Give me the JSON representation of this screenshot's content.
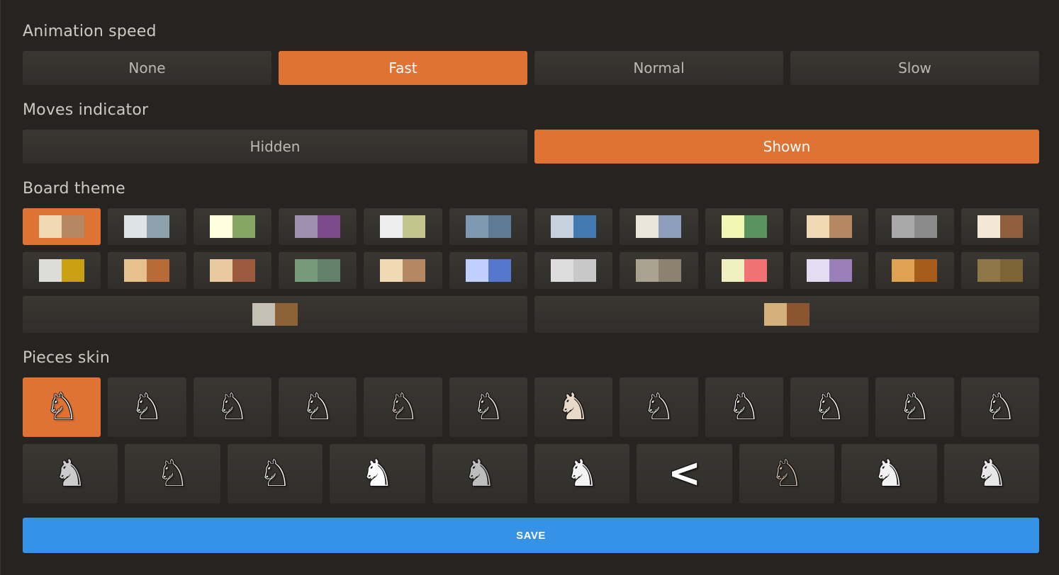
{
  "animation_speed": {
    "title": "Animation speed",
    "options": [
      "None",
      "Fast",
      "Normal",
      "Slow"
    ],
    "selected": "Fast"
  },
  "moves_indicator": {
    "title": "Moves indicator",
    "options": [
      "Hidden",
      "Shown"
    ],
    "selected": "Shown"
  },
  "board_theme": {
    "title": "Board theme",
    "selected_index": 0,
    "themes": [
      {
        "light": "#f0d9b5",
        "dark": "#b58863"
      },
      {
        "light": "#dee3e6",
        "dark": "#8ca2ad"
      },
      {
        "light": "#ffffdd",
        "dark": "#86a666"
      },
      {
        "light": "#9f90b0",
        "dark": "#7d4a8d"
      },
      {
        "light": "#eeeeee",
        "dark": "#c4c48f"
      },
      {
        "light": "#8099b2",
        "dark": "#5f7a94"
      },
      {
        "light": "#c6d1de",
        "dark": "#4279b2"
      },
      {
        "light": "#ece6da",
        "dark": "#8d9ebc"
      },
      {
        "light": "#f1f6b2",
        "dark": "#59935d"
      },
      {
        "light": "#f0d9b5",
        "dark": "#b58863"
      },
      {
        "light": "#a9a9a9",
        "dark": "#8b8b8b"
      },
      {
        "light": "#f4e7d6",
        "dark": "#8f5e3c"
      },
      {
        "light": "#dcdcd8",
        "dark": "#c9a012"
      },
      {
        "light": "#e6c08d",
        "dark": "#b86b36"
      },
      {
        "light": "#e8c9a0",
        "dark": "#9c5a3e"
      },
      {
        "light": "#779a7c",
        "dark": "#62806a"
      },
      {
        "light": "#f0d9b5",
        "dark": "#b58863"
      },
      {
        "light": "#bfcfff",
        "dark": "#5577cc"
      },
      {
        "light": "#dddddd",
        "dark": "#c8c8c8"
      },
      {
        "light": "#a9a28f",
        "dark": "#8b8370"
      },
      {
        "light": "#efefbf",
        "dark": "#f07272"
      },
      {
        "light": "#e4dcf0",
        "dark": "#9a7fb8"
      },
      {
        "light": "#dfa253",
        "dark": "#a85c1c"
      },
      {
        "light": "#8e7648",
        "dark": "#7d6436"
      },
      {
        "light": "#c6bfb4",
        "dark": "#8e6237"
      },
      {
        "light": "#d4b07a",
        "dark": "#8a5530"
      }
    ]
  },
  "pieces_skin": {
    "title": "Pieces skin",
    "selected_index": 0,
    "pieces": [
      {
        "glyph": "♘",
        "fill": "#ffffff"
      },
      {
        "glyph": "♘",
        "fill": "#ffffff"
      },
      {
        "glyph": "♘",
        "fill": "#e8e8e8"
      },
      {
        "glyph": "♘",
        "fill": "#ffffff"
      },
      {
        "glyph": "♘",
        "fill": "#ecdccd"
      },
      {
        "glyph": "♘",
        "fill": "#f4f4f4"
      },
      {
        "glyph": "♞",
        "fill": "#e8d9c8"
      },
      {
        "glyph": "♘",
        "fill": "#f2f2ee"
      },
      {
        "glyph": "♘",
        "fill": "#ffffff"
      },
      {
        "glyph": "♘",
        "fill": "#ffffff"
      },
      {
        "glyph": "♘",
        "fill": "#ffffff"
      },
      {
        "glyph": "♘",
        "fill": "#ffffff"
      },
      {
        "glyph": "♞",
        "fill": "#cccccc"
      },
      {
        "glyph": "♘",
        "fill": "#f0e6d8"
      },
      {
        "glyph": "♘",
        "fill": "#ffffff"
      },
      {
        "glyph": "♞",
        "fill": "#ffffff"
      },
      {
        "glyph": "♞",
        "fill": "#bdbdbd"
      },
      {
        "glyph": "♞",
        "fill": "#f4f4f4"
      },
      {
        "glyph": "<",
        "fill": "#ffffff"
      },
      {
        "glyph": "♘",
        "fill": "#e3cbb4"
      },
      {
        "glyph": "♞",
        "fill": "#f2f2f2"
      },
      {
        "glyph": "♞",
        "fill": "#e8e8e8"
      }
    ]
  },
  "save_label": "SAVE",
  "colors": {
    "accent": "#df7334",
    "save": "#3692e7",
    "background": "#262420",
    "button": "#35322e"
  }
}
